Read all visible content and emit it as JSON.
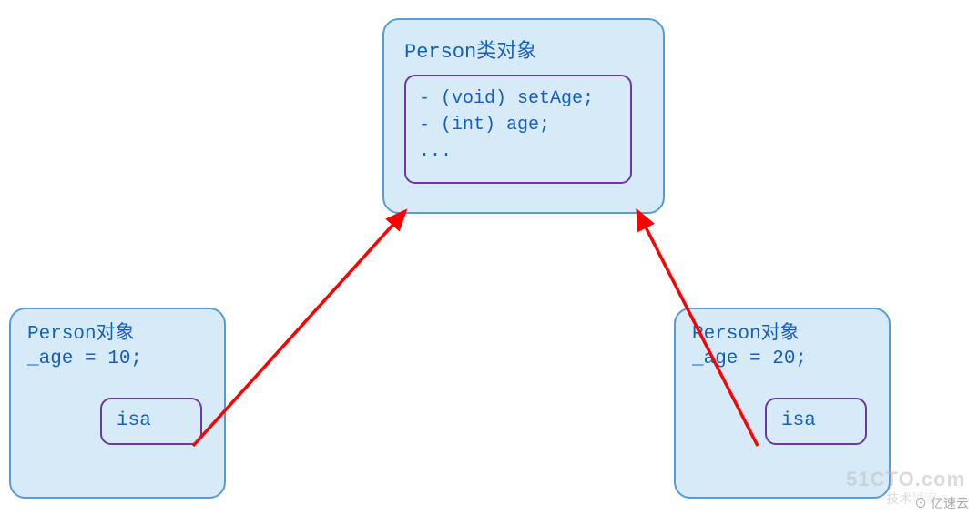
{
  "classBox": {
    "title": "Person类对象",
    "methods": [
      "- (void) setAge;",
      "- (int) age;",
      "..."
    ]
  },
  "leftInstance": {
    "line1": "Person对象",
    "line2": "_age = 10;",
    "isa": "isa"
  },
  "rightInstance": {
    "line1": "Person对象",
    "line2": "_age = 20;",
    "isa": "isa"
  },
  "watermarks": {
    "w1": "51CTO.com",
    "w2": "技术博客  Blog",
    "w3": "⊙ 亿速云"
  },
  "chart_data": {
    "type": "diagram",
    "nodes": [
      {
        "id": "class",
        "label": "Person类对象",
        "kind": "class",
        "methods": [
          "(void) setAge;",
          "(int) age;",
          "..."
        ]
      },
      {
        "id": "inst1",
        "label": "Person对象",
        "kind": "instance",
        "fields": {
          "_age": 10
        },
        "pointer": "isa"
      },
      {
        "id": "inst2",
        "label": "Person对象",
        "kind": "instance",
        "fields": {
          "_age": 20
        },
        "pointer": "isa"
      }
    ],
    "edges": [
      {
        "from": "inst1",
        "to": "class",
        "label": "isa"
      },
      {
        "from": "inst2",
        "to": "class",
        "label": "isa"
      }
    ]
  }
}
